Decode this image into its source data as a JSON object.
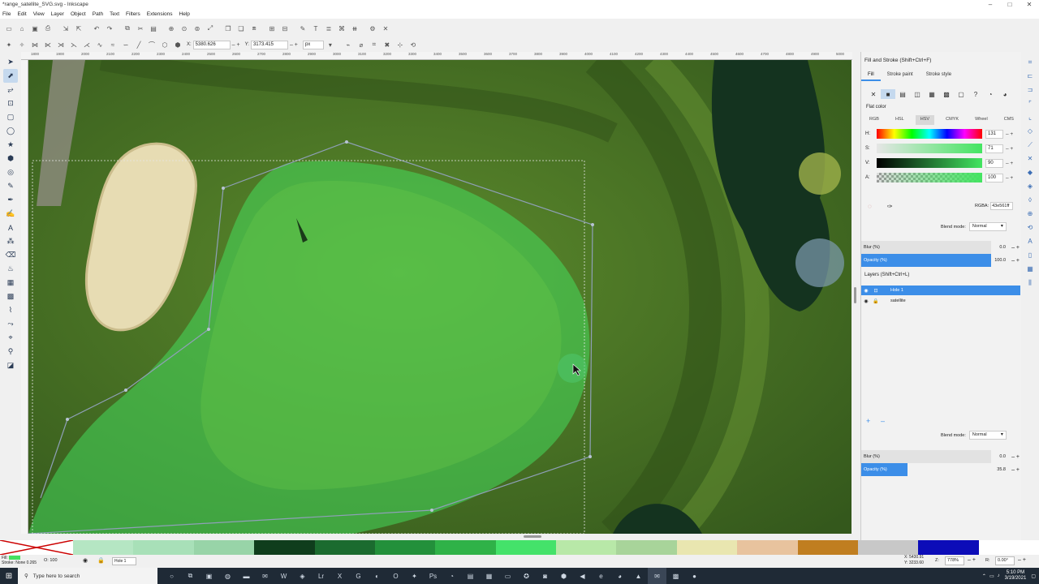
{
  "window": {
    "title": "*range_satellite_SVG.svg - Inkscape",
    "controls": [
      "–",
      "□",
      "✕"
    ]
  },
  "menu": [
    "File",
    "Edit",
    "View",
    "Layer",
    "Object",
    "Path",
    "Text",
    "Filters",
    "Extensions",
    "Help"
  ],
  "ctrlbar": {
    "x_label": "X:",
    "x_value": "5380.626",
    "y_label": "Y:",
    "y_value": "3173.415",
    "unit": "px",
    "plusminus": "– +"
  },
  "ruler_ticks": [
    "1800",
    "1900",
    "2000",
    "2100",
    "2200",
    "2300",
    "2400",
    "2500",
    "2600",
    "2700",
    "2800",
    "2900",
    "3000",
    "3100",
    "3200",
    "3300",
    "3400",
    "3500",
    "3600",
    "3700",
    "3800",
    "3900",
    "4000",
    "4100",
    "4200",
    "4300",
    "4400",
    "4500",
    "4600",
    "4700",
    "4800",
    "4900",
    "5000"
  ],
  "fill_stroke": {
    "title": "Fill and Stroke (Shift+Ctrl+F)",
    "tabs": [
      "Fill",
      "Stroke paint",
      "Stroke style"
    ],
    "flat_color": "Flat color",
    "modes": [
      "RGB",
      "HSL",
      "HSV",
      "CMYK",
      "Wheel",
      "CMS"
    ],
    "sliders": [
      {
        "ch": "H:",
        "value": "131"
      },
      {
        "ch": "S:",
        "value": "71"
      },
      {
        "ch": "V:",
        "value": "90"
      },
      {
        "ch": "A:",
        "value": "100"
      }
    ],
    "rgba_label": "RGBA:",
    "rgba_value": "43e561ff",
    "blend_label": "Blend mode:",
    "blend_value": "Normal",
    "blur_label": "Blur (%)",
    "blur_value": "0.0",
    "opacity_label": "Opacity (%)",
    "opacity_value": "100.0",
    "opacity_fraction": 1.0,
    "accent": "#3c8ee8"
  },
  "layers": {
    "title": "Layers (Shift+Ctrl+L)",
    "items": [
      {
        "name": "Hole 1",
        "selected": true
      },
      {
        "name": "satellite",
        "selected": false
      }
    ],
    "blend_label": "Blend mode:",
    "blend_value": "Normal",
    "blur_label": "Blur (%)",
    "blur_value": "0.0",
    "opacity_label": "Opacity (%)",
    "opacity_value": "35.8",
    "opacity_fraction": 0.358
  },
  "palette": [
    "#b5e6c3",
    "#a8e0b8",
    "#98d4a8",
    "#0f3d1c",
    "#1b6b2f",
    "#23903b",
    "#2fb248",
    "#44e26a",
    "#b8e8a8",
    "#a8d49a",
    "#e9e6b0",
    "#e8c39e",
    "#c07e20",
    "#c8c8c8",
    "#0c0cb8",
    "#ffffff"
  ],
  "status": {
    "fill_label": "Fill:",
    "stroke_label": "Stroke:",
    "stroke_value": "None",
    "stroke_width": "0.265",
    "o_label": "O:",
    "o_value": "100",
    "layer": "Hole 1",
    "x_coord": "X: 5430.91",
    "y_coord": "Y: 3233.60",
    "z_label": "Z:",
    "zoom": "778%",
    "r_label": "R:",
    "rotation": "0.00°"
  },
  "taskbar": {
    "search_placeholder": "Type here to search",
    "time": "5:10 PM",
    "date": "3/19/2021"
  }
}
